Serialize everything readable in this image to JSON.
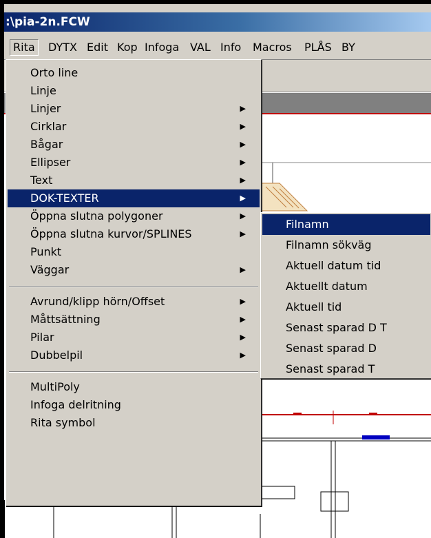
{
  "window": {
    "title": ":\\pia-2n.FCW"
  },
  "menubar": {
    "items": [
      "Rita",
      "DYTX",
      "Edit",
      "Kop",
      "Infoga",
      "VAL",
      "Info",
      "Macros",
      "PLÅS",
      "BY"
    ],
    "active": "Rita"
  },
  "rita_menu": {
    "items": [
      {
        "label": "Orto line",
        "submenu": false
      },
      {
        "label": "Linje",
        "submenu": false
      },
      {
        "label": "Linjer",
        "submenu": true
      },
      {
        "label": "Cirklar",
        "submenu": true
      },
      {
        "label": "Bågar",
        "submenu": true
      },
      {
        "label": "Ellipser",
        "submenu": true
      },
      {
        "label": "Text",
        "submenu": true
      },
      {
        "label": "DOK-TEXTER",
        "submenu": true,
        "highlighted": true
      },
      {
        "label": "Öppna  slutna polygoner",
        "submenu": true
      },
      {
        "label": "Öppna  slutna kurvor/SPLINES",
        "submenu": true
      },
      {
        "label": "Punkt",
        "submenu": false
      },
      {
        "label": "Väggar",
        "submenu": true
      },
      {
        "label": "Avrund/klipp hörn/Offset",
        "submenu": true
      },
      {
        "label": "Måttsättning",
        "submenu": true
      },
      {
        "label": "Pilar",
        "submenu": true
      },
      {
        "label": "Dubbelpil",
        "submenu": true
      },
      {
        "label": "MultiPoly",
        "submenu": false
      },
      {
        "label": "Infoga delritning",
        "submenu": false
      },
      {
        "label": "Rita symbol",
        "submenu": false
      }
    ]
  },
  "dok_texter_submenu": {
    "items": [
      {
        "label": "Filnamn",
        "highlighted": true
      },
      {
        "label": "Filnamn  sökväg"
      },
      {
        "label": "Aktuell datum  tid"
      },
      {
        "label": "Aktuellt datum"
      },
      {
        "label": "Aktuell tid"
      },
      {
        "label": "Senast sparad D  T"
      },
      {
        "label": "Senast sparad D"
      },
      {
        "label": "Senast sparad T"
      }
    ]
  },
  "colors": {
    "highlight": "#0a246a",
    "menu_bg": "#d4d0c8",
    "title_bar": "#0a246a"
  }
}
